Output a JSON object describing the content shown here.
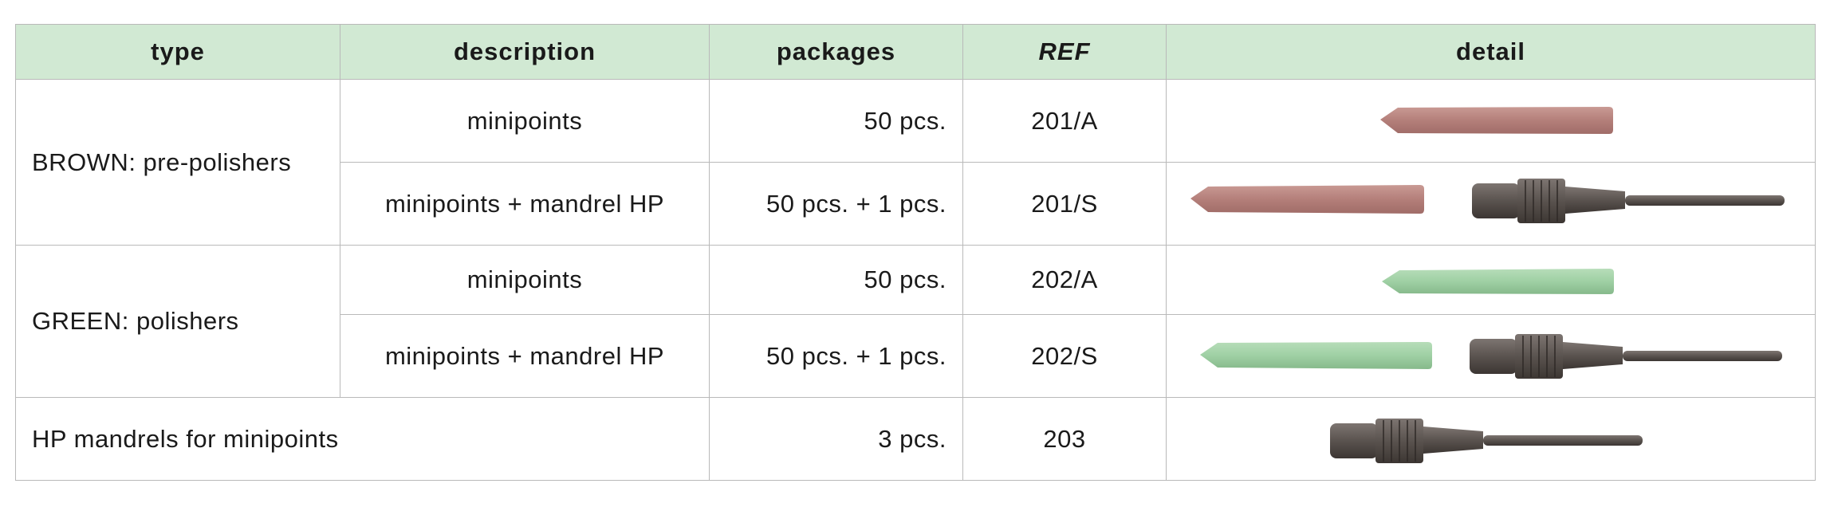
{
  "table": {
    "headers": {
      "type": "type",
      "description": "description",
      "packages": "packages",
      "ref": "REF",
      "detail": "detail"
    },
    "groups": {
      "brown": "BROWN: pre-polishers",
      "green": "GREEN: polishers"
    },
    "rows": [
      {
        "description": "minipoints",
        "packages": "50 pcs.",
        "ref": "201/A",
        "detail": "brown-minipoint"
      },
      {
        "description": "minipoints + mandrel HP",
        "packages": "50 pcs. + 1 pcs.",
        "ref": "201/S",
        "detail": "brown-minipoint-and-mandrel"
      },
      {
        "description": "minipoints",
        "packages": "50 pcs.",
        "ref": "202/A",
        "detail": "green-minipoint"
      },
      {
        "description": "minipoints + mandrel HP",
        "packages": "50 pcs. + 1 pcs.",
        "ref": "202/S",
        "detail": "green-minipoint-and-mandrel"
      },
      {
        "description": "HP mandrels for minipoints",
        "packages": "3 pcs.",
        "ref": "203",
        "detail": "hp-mandrel"
      }
    ]
  },
  "colors": {
    "header_bg": "#d1e9d3",
    "brown_point": "#b47f7a",
    "green_point": "#9fd0a4",
    "mandrel": "#5a534f"
  }
}
